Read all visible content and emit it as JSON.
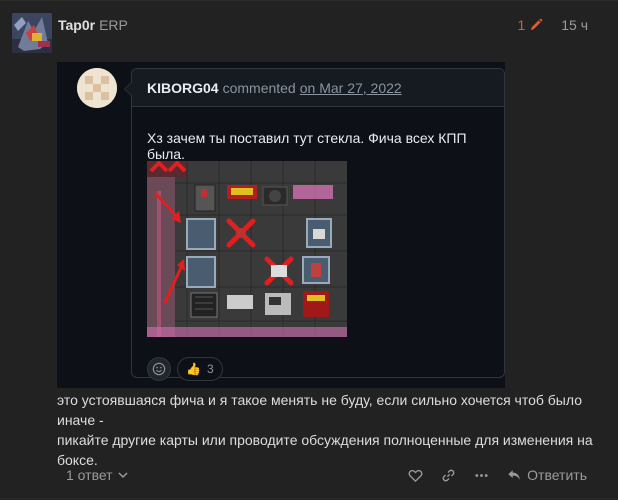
{
  "post": {
    "username": "Tap0r",
    "group": "ERP",
    "edits": "1",
    "date": "15 ч",
    "body_lines": [
      "это устоявшаяся фича и я такое менять не буду, если сильно хочется чтоб было иначе -",
      "пикайте другие карты или проводите обсуждения полноценные для изменения на боксе."
    ]
  },
  "embed": {
    "commenter": "KIBORG04",
    "commented": "commented",
    "date_link": "on Mar 27, 2022",
    "text": "Хз зачем ты поставил тут стекла. Фича всех КПП была.",
    "reaction": {
      "emoji": "👍",
      "count": "3"
    }
  },
  "controls": {
    "replies": "1 ответ",
    "reply": "Ответить"
  },
  "colors": {
    "background": "#222222",
    "accent_edit": "#e45735",
    "embed_bg": "#0d1117",
    "embed_border": "#30363d"
  },
  "icons": [
    "pencil-icon",
    "smiley-icon",
    "chevron-down-icon",
    "heart-icon",
    "link-icon",
    "more-icon",
    "reply-icon"
  ]
}
